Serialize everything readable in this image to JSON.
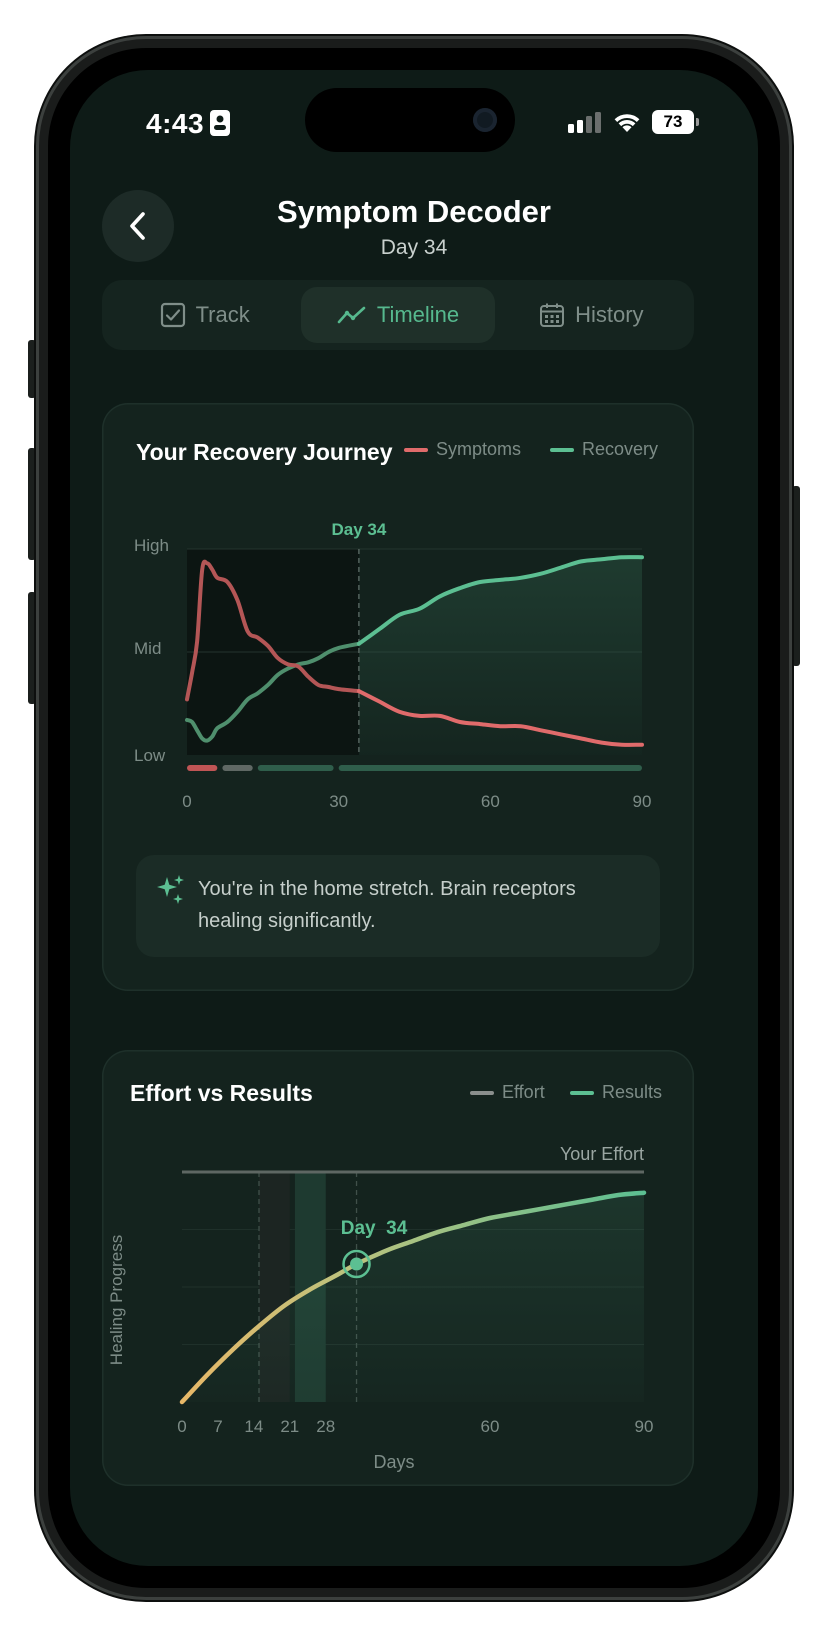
{
  "status_bar": {
    "time": "4:43",
    "battery": "73"
  },
  "header": {
    "title": "Symptom Decoder",
    "subtitle": "Day 34"
  },
  "tabs": [
    {
      "label": "Track",
      "icon": "checkbox-icon"
    },
    {
      "label": "Timeline",
      "icon": "trend-line-icon",
      "active": true
    },
    {
      "label": "History",
      "icon": "calendar-icon"
    }
  ],
  "colors": {
    "symptoms": "#e06b6b",
    "recovery": "#5cbf92",
    "effort": "#8a8f8d",
    "results": "#5cbf92",
    "accent": "#56b98e"
  },
  "journey": {
    "title": "Your Recovery Journey",
    "legend": {
      "symptoms": "Symptoms",
      "recovery": "Recovery"
    },
    "marker_label": "Day  34",
    "y_ticks": [
      "High",
      "Mid",
      "Low"
    ],
    "insight": "You're in the home stretch. Brain receptors healing significantly."
  },
  "effort": {
    "title": "Effort vs Results",
    "legend": {
      "effort": "Effort",
      "results": "Results"
    },
    "effort_label": "Your Effort",
    "marker_label": "Day  34",
    "y_label": "Healing Progress",
    "x_label": "Days"
  },
  "chart_data": [
    {
      "type": "line",
      "title": "Your Recovery Journey",
      "x_domain": [
        0,
        90
      ],
      "x_ticks": [
        0,
        30,
        60,
        90
      ],
      "y_ticks": [
        "Low",
        "Mid",
        "High"
      ],
      "ylim": [
        0,
        100
      ],
      "marker_day": 34,
      "series": [
        {
          "name": "Symptoms",
          "points": [
            [
              0,
              27
            ],
            [
              1,
              40
            ],
            [
              2,
              55
            ],
            [
              3,
              90
            ],
            [
              4,
              93
            ],
            [
              5,
              90
            ],
            [
              6,
              86
            ],
            [
              8,
              84
            ],
            [
              10,
              75
            ],
            [
              12,
              60
            ],
            [
              14,
              57
            ],
            [
              16,
              53
            ],
            [
              18,
              47
            ],
            [
              20,
              44
            ],
            [
              22,
              43
            ],
            [
              24,
              38
            ],
            [
              26,
              34
            ],
            [
              28,
              33
            ],
            [
              30,
              32
            ],
            [
              34,
              31
            ],
            [
              38,
              26
            ],
            [
              42,
              21
            ],
            [
              46,
              19
            ],
            [
              50,
              19
            ],
            [
              54,
              16
            ],
            [
              58,
              15
            ],
            [
              62,
              14
            ],
            [
              66,
              14
            ],
            [
              70,
              12
            ],
            [
              74,
              10
            ],
            [
              78,
              8
            ],
            [
              82,
              6
            ],
            [
              86,
              5
            ],
            [
              90,
              5
            ]
          ]
        },
        {
          "name": "Recovery",
          "points": [
            [
              0,
              17
            ],
            [
              1,
              16
            ],
            [
              2,
              12
            ],
            [
              3,
              8
            ],
            [
              4,
              7
            ],
            [
              5,
              9
            ],
            [
              6,
              13
            ],
            [
              8,
              16
            ],
            [
              10,
              21
            ],
            [
              12,
              27
            ],
            [
              14,
              30
            ],
            [
              16,
              34
            ],
            [
              18,
              39
            ],
            [
              20,
              42
            ],
            [
              22,
              44
            ],
            [
              24,
              45
            ],
            [
              26,
              47
            ],
            [
              28,
              50
            ],
            [
              30,
              52
            ],
            [
              34,
              54
            ],
            [
              38,
              61
            ],
            [
              42,
              68
            ],
            [
              46,
              71
            ],
            [
              50,
              77
            ],
            [
              54,
              81
            ],
            [
              58,
              84
            ],
            [
              62,
              85
            ],
            [
              66,
              86
            ],
            [
              70,
              88
            ],
            [
              74,
              91
            ],
            [
              78,
              94
            ],
            [
              82,
              95
            ],
            [
              86,
              96
            ],
            [
              90,
              96
            ]
          ]
        }
      ],
      "phase_bar": [
        {
          "from": 0,
          "to": 6,
          "color": "#c05555"
        },
        {
          "from": 7,
          "to": 13,
          "color": "#5f6864"
        },
        {
          "from": 14,
          "to": 29,
          "color": "#2f5e4b"
        },
        {
          "from": 30,
          "to": 90,
          "color": "#2f5e4b"
        }
      ]
    },
    {
      "type": "line",
      "title": "Effort vs Results",
      "xlabel": "Days",
      "ylabel": "Healing Progress",
      "x_domain": [
        0,
        90
      ],
      "x_ticks": [
        0,
        7,
        14,
        21,
        28,
        60,
        90
      ],
      "ylim": [
        0,
        100
      ],
      "marker_day": 34,
      "series": [
        {
          "name": "Effort",
          "points": [
            [
              0,
              100
            ],
            [
              90,
              100
            ]
          ]
        },
        {
          "name": "Results",
          "points": [
            [
              0,
              0
            ],
            [
              5,
              12
            ],
            [
              10,
              23
            ],
            [
              15,
              33
            ],
            [
              20,
              42
            ],
            [
              25,
              49
            ],
            [
              30,
              55
            ],
            [
              34,
              60
            ],
            [
              40,
              66
            ],
            [
              45,
              70
            ],
            [
              50,
              74
            ],
            [
              55,
              77
            ],
            [
              60,
              80
            ],
            [
              65,
              82
            ],
            [
              70,
              84
            ],
            [
              75,
              86
            ],
            [
              80,
              88
            ],
            [
              85,
              90
            ],
            [
              90,
              91
            ]
          ]
        }
      ],
      "bands": [
        {
          "from": 15,
          "to": 21
        },
        {
          "from": 22,
          "to": 28
        }
      ]
    }
  ]
}
